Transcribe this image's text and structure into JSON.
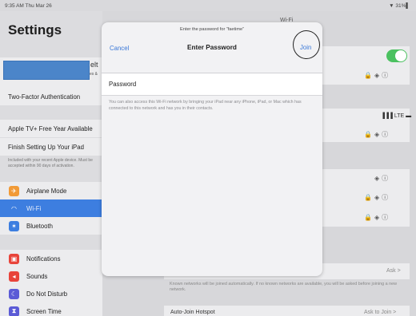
{
  "status": {
    "time": "9:35 AM  Thu Mar 26",
    "battery": "▼ 31%▌"
  },
  "sidebar": {
    "title": "Settings",
    "profile_name_fragment": "elt",
    "profile_sub_fragment": "es &",
    "two_factor": "Two-Factor Authentication",
    "apple_tv": "Apple TV+ Free Year Available",
    "finish_setup": "Finish Setting Up Your iPad",
    "note": "Included with your recent Apple device. Must be accepted within 90 days of activation.",
    "items": [
      {
        "label": "Airplane Mode",
        "icon": "airplane-icon",
        "color": "#f19a37",
        "glyph": "✈"
      },
      {
        "label": "Wi-Fi",
        "icon": "wifi-icon",
        "color": "#3d7ee0",
        "glyph": "◠"
      },
      {
        "label": "Bluetooth",
        "icon": "bluetooth-icon",
        "color": "#3d7ee0",
        "glyph": "✶"
      },
      {
        "label": "Notifications",
        "icon": "notifications-icon",
        "color": "#e8443a",
        "glyph": "▣"
      },
      {
        "label": "Sounds",
        "icon": "sounds-icon",
        "color": "#e8443a",
        "glyph": "◂"
      },
      {
        "label": "Do Not Disturb",
        "icon": "moon-icon",
        "color": "#5b5bd6",
        "glyph": "☾"
      },
      {
        "label": "Screen Time",
        "icon": "hourglass-icon",
        "color": "#5b5bd6",
        "glyph": "⧗"
      }
    ]
  },
  "wifi_pane": {
    "title": "Wi-Fi",
    "lte": "▐▐▐ LTE ▬",
    "ask_label": "Ask  >",
    "known_note": "Known networks will be joined automatically. If no known networks are available, you will be asked before joining a new network.",
    "hotspot_label": "Auto-Join Hotspot",
    "hotspot_value": "Ask to Join  >"
  },
  "modal": {
    "prompt": "Enter the password for “faetime”",
    "cancel": "Cancel",
    "title": "Enter Password",
    "join": "Join",
    "password_label": "Password",
    "password_value": "",
    "note": "You can also access this Wi-Fi network by bringing your iPad near any iPhone, iPad, or Mac which has connected to this network and has you in their contacts."
  },
  "colors": {
    "accent": "#3a78d8",
    "toggle_on": "#4bc160",
    "selected_row": "#3d7ee0"
  }
}
